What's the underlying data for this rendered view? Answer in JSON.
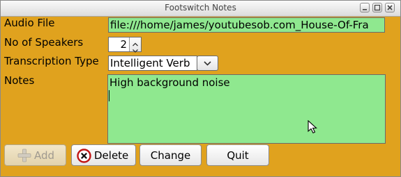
{
  "window": {
    "title": "Footswitch Notes"
  },
  "labels": {
    "audio_file": "Audio File",
    "speakers": "No of Speakers",
    "transcription_type": "Transcription Type",
    "notes": "Notes"
  },
  "fields": {
    "audio_file_value": "file:///home/james/youtubesob.com_House-Of-Fra",
    "speakers_value": "2",
    "transcription_type_value": "Intelligent Verb",
    "notes_text": "High background noise"
  },
  "buttons": {
    "add": "Add",
    "delete": "Delete",
    "change": "Change",
    "quit": "Quit"
  },
  "colors": {
    "window_bg": "#e0a21e",
    "field_bg": "#8fe88f"
  },
  "icons": {
    "add": "plus-icon",
    "delete": "delete-circle-x-icon",
    "combo": "chevron-down-icon",
    "spin_up": "spin-up-arrow-icon",
    "spin_down": "spin-down-arrow-icon"
  }
}
